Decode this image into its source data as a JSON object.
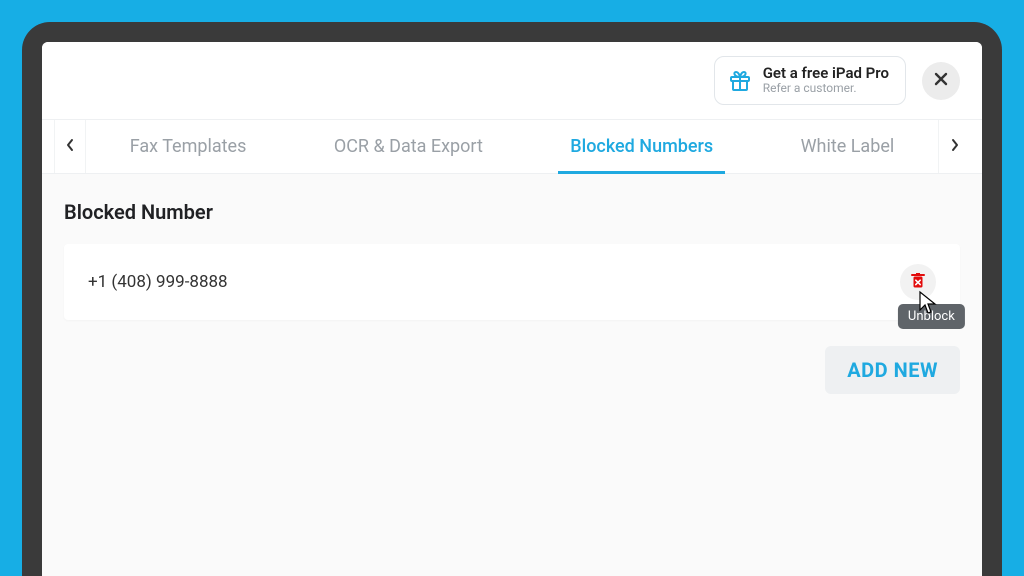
{
  "header": {
    "promo_title": "Get a free iPad Pro",
    "promo_subtitle": "Refer a customer."
  },
  "tabs": {
    "items": [
      {
        "label": "Fax Templates"
      },
      {
        "label": "OCR & Data Export"
      },
      {
        "label": "Blocked Numbers"
      },
      {
        "label": "White Label"
      }
    ],
    "active_index": 2
  },
  "section": {
    "title": "Blocked Number"
  },
  "blocked_numbers": [
    {
      "phone": "+1 (408) 999-8888"
    }
  ],
  "tooltip": {
    "unblock": "Unblock"
  },
  "actions": {
    "add_new": "ADD NEW"
  }
}
